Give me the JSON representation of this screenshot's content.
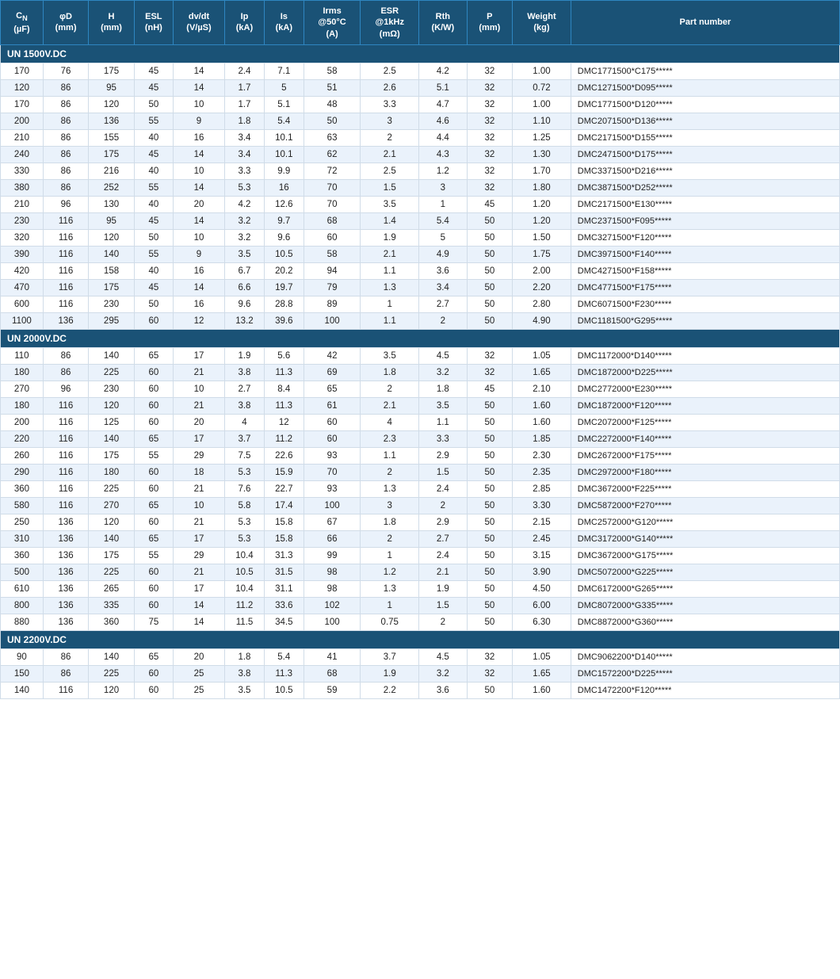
{
  "table": {
    "headers": [
      {
        "id": "cn",
        "line1": "C",
        "sub": "N",
        "line2": "(µF)"
      },
      {
        "id": "phiD",
        "line1": "φD",
        "line2": "(mm)"
      },
      {
        "id": "H",
        "line1": "H",
        "line2": "(mm)"
      },
      {
        "id": "ESL",
        "line1": "ESL",
        "line2": "(nH)"
      },
      {
        "id": "dvdt",
        "line1": "dv/dt",
        "line2": "(V/µS)"
      },
      {
        "id": "Ip",
        "line1": "Ip",
        "line2": "(kA)"
      },
      {
        "id": "Is",
        "line1": "Is",
        "line2": "(kA)"
      },
      {
        "id": "Irms",
        "line1": "Irms",
        "line2": "@50°C",
        "line3": "(A)"
      },
      {
        "id": "ESR",
        "line1": "ESR",
        "line2": "@1kHz",
        "line3": "(mΩ)"
      },
      {
        "id": "Rth",
        "line1": "Rth",
        "line2": "(K/W)"
      },
      {
        "id": "P",
        "line1": "P",
        "line2": "(mm)"
      },
      {
        "id": "Weight",
        "line1": "Weight",
        "line2": "(kg)"
      },
      {
        "id": "partnum",
        "line1": "Part number"
      }
    ],
    "sections": [
      {
        "label": "UN 1500V.DC",
        "rows": [
          [
            170,
            76,
            175,
            45,
            14,
            2.4,
            7.1,
            58,
            2.5,
            4.2,
            32,
            "1.00",
            "DMC1771500*C175*****"
          ],
          [
            120,
            86,
            95,
            45,
            14,
            1.7,
            5.0,
            51,
            2.6,
            5.1,
            32,
            "0.72",
            "DMC1271500*D095*****"
          ],
          [
            170,
            86,
            120,
            50,
            10,
            1.7,
            5.1,
            48,
            3.3,
            4.7,
            32,
            "1.00",
            "DMC1771500*D120*****"
          ],
          [
            200,
            86,
            136,
            55,
            9,
            1.8,
            5.4,
            50,
            3.0,
            4.6,
            32,
            "1.10",
            "DMC2071500*D136*****"
          ],
          [
            210,
            86,
            155,
            40,
            16,
            3.4,
            10.1,
            63,
            2.0,
            4.4,
            32,
            "1.25",
            "DMC2171500*D155*****"
          ],
          [
            240,
            86,
            175,
            45,
            14,
            3.4,
            10.1,
            62,
            2.1,
            4.3,
            32,
            "1.30",
            "DMC2471500*D175*****"
          ],
          [
            330,
            86,
            216,
            40,
            10,
            3.3,
            9.9,
            72,
            2.5,
            1.2,
            32,
            "1.70",
            "DMC3371500*D216*****"
          ],
          [
            380,
            86,
            252,
            55,
            14,
            5.3,
            16.0,
            70,
            1.5,
            3.0,
            32,
            "1.80",
            "DMC3871500*D252*****"
          ],
          [
            210,
            96,
            130,
            40,
            20,
            4.2,
            12.6,
            70,
            3.5,
            1.0,
            45,
            "1.20",
            "DMC2171500*E130*****"
          ],
          [
            230,
            116,
            95,
            45,
            14,
            3.2,
            9.7,
            68,
            1.4,
            5.4,
            50,
            "1.20",
            "DMC2371500*F095*****"
          ],
          [
            320,
            116,
            120,
            50,
            10,
            3.2,
            9.6,
            60,
            1.9,
            5.0,
            50,
            "1.50",
            "DMC3271500*F120*****"
          ],
          [
            390,
            116,
            140,
            55,
            9,
            3.5,
            10.5,
            58,
            2.1,
            4.9,
            50,
            "1.75",
            "DMC3971500*F140*****"
          ],
          [
            420,
            116,
            158,
            40,
            16,
            6.7,
            20.2,
            94,
            1.1,
            3.6,
            50,
            "2.00",
            "DMC4271500*F158*****"
          ],
          [
            470,
            116,
            175,
            45,
            14,
            6.6,
            19.7,
            79,
            1.3,
            3.4,
            50,
            "2.20",
            "DMC4771500*F175*****"
          ],
          [
            600,
            116,
            230,
            50,
            16,
            9.6,
            28.8,
            89,
            1.0,
            2.7,
            50,
            "2.80",
            "DMC6071500*F230*****"
          ],
          [
            1100,
            136,
            295,
            60,
            12,
            13.2,
            39.6,
            100,
            1.1,
            2.0,
            50,
            "4.90",
            "DMC1181500*G295*****"
          ]
        ]
      },
      {
        "label": "UN 2000V.DC",
        "rows": [
          [
            110,
            86,
            140,
            65,
            17,
            1.9,
            5.6,
            42,
            3.5,
            4.5,
            32,
            "1.05",
            "DMC1172000*D140*****"
          ],
          [
            180,
            86,
            225,
            60,
            21,
            3.8,
            11.3,
            69,
            1.8,
            3.2,
            32,
            "1.65",
            "DMC1872000*D225*****"
          ],
          [
            270,
            96,
            230,
            60,
            10,
            2.7,
            8.4,
            65,
            2.0,
            1.8,
            45,
            "2.10",
            "DMC2772000*E230*****"
          ],
          [
            180,
            116,
            120,
            60,
            21,
            3.8,
            11.3,
            61,
            2.1,
            3.5,
            50,
            "1.60",
            "DMC1872000*F120*****"
          ],
          [
            200,
            116,
            125,
            60,
            20,
            4,
            12,
            60,
            4,
            1.1,
            50,
            "1.60",
            "DMC2072000*F125*****"
          ],
          [
            220,
            116,
            140,
            65,
            17,
            3.7,
            11.2,
            60,
            2.3,
            3.3,
            50,
            "1.85",
            "DMC2272000*F140*****"
          ],
          [
            260,
            116,
            175,
            55,
            29,
            7.5,
            22.6,
            93,
            1.1,
            2.9,
            50,
            "2.30",
            "DMC2672000*F175*****"
          ],
          [
            290,
            116,
            180,
            60,
            18,
            5.3,
            15.9,
            70,
            2,
            1.5,
            50,
            "2.35",
            "DMC2972000*F180*****"
          ],
          [
            360,
            116,
            225,
            60,
            21,
            7.6,
            22.7,
            93,
            1.3,
            2.4,
            50,
            "2.85",
            "DMC3672000*F225*****"
          ],
          [
            580,
            116,
            270,
            65,
            10,
            5.8,
            17.4,
            100,
            3,
            2.0,
            50,
            "3.30",
            "DMC5872000*F270*****"
          ],
          [
            250,
            136,
            120,
            60,
            21,
            5.3,
            15.8,
            67,
            1.8,
            2.9,
            50,
            "2.15",
            "DMC2572000*G120*****"
          ],
          [
            310,
            136,
            140,
            65,
            17,
            5.3,
            15.8,
            66,
            2.0,
            2.7,
            50,
            "2.45",
            "DMC3172000*G140*****"
          ],
          [
            360,
            136,
            175,
            55,
            29,
            10.4,
            31.3,
            99,
            1.0,
            2.4,
            50,
            "3.15",
            "DMC3672000*G175*****"
          ],
          [
            500,
            136,
            225,
            60,
            21,
            10.5,
            31.5,
            98,
            1.2,
            2.1,
            50,
            "3.90",
            "DMC5072000*G225*****"
          ],
          [
            610,
            136,
            265,
            60,
            17,
            10.4,
            31.1,
            98,
            1.3,
            1.9,
            50,
            "4.50",
            "DMC6172000*G265*****"
          ],
          [
            800,
            136,
            335,
            60,
            14,
            11.2,
            33.6,
            102,
            1.0,
            1.5,
            50,
            "6.00",
            "DMC8072000*G335*****"
          ],
          [
            880,
            136,
            360,
            75,
            14,
            11.5,
            34.5,
            100,
            0.75,
            2,
            50,
            "6.30",
            "DMC8872000*G360*****"
          ]
        ]
      },
      {
        "label": "UN 2200V.DC",
        "rows": [
          [
            90,
            86,
            140,
            65,
            20,
            1.8,
            5.4,
            41,
            3.7,
            4.5,
            32,
            "1.05",
            "DMC9062200*D140*****"
          ],
          [
            150,
            86,
            225,
            60,
            25,
            3.8,
            11.3,
            68,
            1.9,
            3.2,
            32,
            "1.65",
            "DMC1572200*D225*****"
          ],
          [
            140,
            116,
            120,
            60,
            25,
            3.5,
            10.5,
            59,
            2.2,
            3.6,
            50,
            "1.60",
            "DMC1472200*F120*****"
          ]
        ]
      }
    ]
  }
}
